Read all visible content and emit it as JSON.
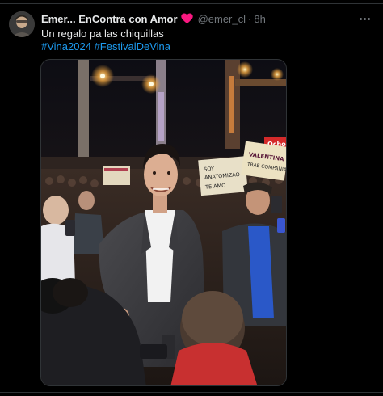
{
  "tweet": {
    "display_name": "Emer... EnContra con Amor",
    "handle": "@emer_cl",
    "separator": "·",
    "timestamp": "8h",
    "text": "Un regalo pa las chiquillas",
    "hashtags": [
      "#Vina2024",
      "#FestivalDeVina"
    ]
  },
  "media": {
    "alt": "Photo of a smiling man in a dark suit and white shirt walking through a crowd at an outdoor concert venue at night, with fans holding handwritten signs behind him.",
    "signs": [
      "Ocho",
      "SOY ANATOMIZAO TE AMO",
      "VALENTINA TRAE COMPANIA"
    ]
  },
  "colors": {
    "background": "#000000",
    "text_primary": "#e7e9ea",
    "text_secondary": "#71767b",
    "link": "#1d9bf0",
    "heart": "#f91880",
    "border": "#2f3336"
  },
  "icons": {
    "heart": "heart-icon",
    "more": "more-dots-icon"
  }
}
